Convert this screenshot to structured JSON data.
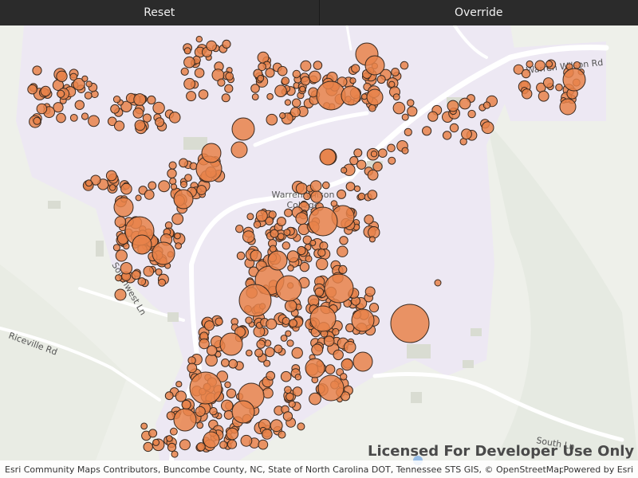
{
  "toolbar": {
    "reset_label": "Reset",
    "override_label": "Override"
  },
  "map": {
    "labels": {
      "road_warren_wilson": "Warren Wilson Rd",
      "place_college": "Warren Wilson",
      "place_college_line2": "College",
      "road_southwest": "Southwest Ln",
      "road_riceville": "Riceville Rd",
      "road_south": "South Ln"
    },
    "watermark": "Licensed For Developer Use Only",
    "attribution": "Esri Community Maps Contributors, Buncombe County, NC, State of North Carolina DOT, Tennessee STS GIS, © OpenStreetMap, M...",
    "powered_by": "Powered by Esri"
  },
  "colors": {
    "point_fill": "#e8834a",
    "point_stroke": "#3a2a20",
    "campus_fill": "#ede8f3",
    "background": "#eef0ea",
    "road": "#ffffff"
  }
}
